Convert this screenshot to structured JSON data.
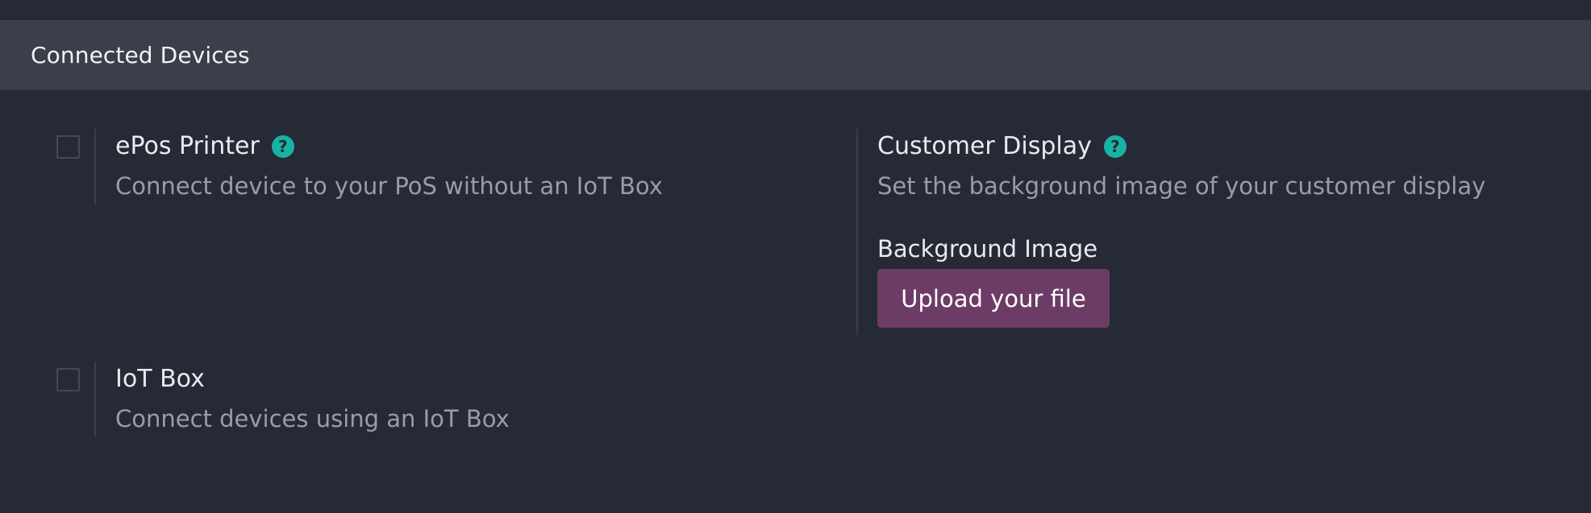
{
  "section": {
    "title": "Connected Devices"
  },
  "settings": [
    {
      "label": "ePos Printer",
      "description": "Connect device to your PoS without an IoT Box",
      "help_icon": "?",
      "checked": false
    },
    {
      "label": "Customer Display",
      "description": "Set the background image of your customer display",
      "help_icon": "?",
      "field_label": "Background Image",
      "button_label": "Upload your file"
    },
    {
      "label": "IoT Box",
      "description": "Connect devices using an IoT Box",
      "checked": false
    }
  ],
  "colors": {
    "background": "#262a36",
    "header": "#3c3e4b",
    "help_icon": "#17b4a3",
    "primary_button": "#6d3c66"
  }
}
